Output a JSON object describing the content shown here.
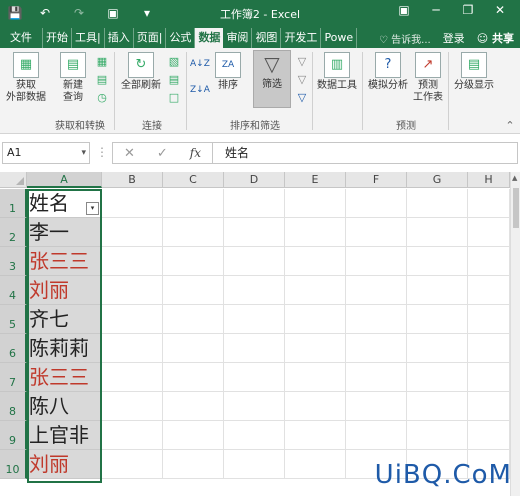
{
  "window": {
    "title": "工作簿2 - Excel",
    "titlebar_icons": [
      "save-icon",
      "undo-icon",
      "redo-icon",
      "camera-icon",
      "customize-icon"
    ],
    "window_controls": [
      "ribbon-display-icon",
      "minimize-icon",
      "restore-icon",
      "close-icon"
    ]
  },
  "tabs": [
    {
      "label": "文件",
      "active": false
    },
    {
      "label": "开始",
      "active": false
    },
    {
      "label": "工具|",
      "active": false
    },
    {
      "label": "插入",
      "active": false
    },
    {
      "label": "页面|",
      "active": false
    },
    {
      "label": "公式",
      "active": false
    },
    {
      "label": "数据",
      "active": true
    },
    {
      "label": "审阅",
      "active": false
    },
    {
      "label": "视图",
      "active": false
    },
    {
      "label": "开发工",
      "active": false
    },
    {
      "label": "Powe",
      "active": false
    }
  ],
  "tab_right": {
    "tell_me": "告诉我...",
    "account": "登录",
    "share": "共享"
  },
  "ribbon": {
    "get_external": "获取\n外部数据",
    "new_query": "新建\n查询",
    "refresh_all": "全部刷新",
    "sort": "排序",
    "filter": "筛选",
    "data_tools": "数据工具",
    "what_if": "模拟分析",
    "forecast_sheet": "预测\n工作表",
    "outline": "分级显示",
    "groups": {
      "get_transform": "获取和转换",
      "connections": "连接",
      "sort_filter": "排序和筛选",
      "forecast": "预测"
    }
  },
  "formula_bar": {
    "name_box": "A1",
    "fx": "fx",
    "cancel": "✕",
    "enter": "✓",
    "content": "姓名"
  },
  "columns": [
    "A",
    "B",
    "C",
    "D",
    "E",
    "F",
    "G",
    "H"
  ],
  "rows": [
    {
      "num": "1",
      "value": "姓名",
      "red": false
    },
    {
      "num": "2",
      "value": "李一",
      "red": false
    },
    {
      "num": "3",
      "value": "张三三",
      "red": true
    },
    {
      "num": "4",
      "value": "刘丽",
      "red": true
    },
    {
      "num": "5",
      "value": "齐七",
      "red": false
    },
    {
      "num": "6",
      "value": "陈莉莉",
      "red": false
    },
    {
      "num": "7",
      "value": "张三三",
      "red": true
    },
    {
      "num": "8",
      "value": "陈八",
      "red": false
    },
    {
      "num": "9",
      "value": "上官非",
      "red": false
    },
    {
      "num": "10",
      "value": "刘丽",
      "red": true
    }
  ],
  "colors": {
    "excel_green": "#217346",
    "duplicate_red": "#c0392b",
    "ribbon_bg": "#f3f3f3"
  },
  "watermark": "UiBQ.CoM"
}
